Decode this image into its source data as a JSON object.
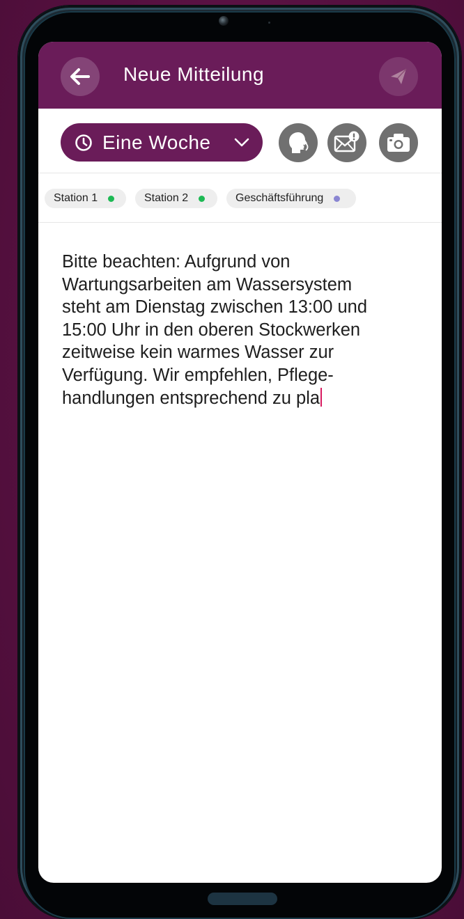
{
  "app_bar": {
    "title": "Neue Mitteilung",
    "back_icon": "arrow-left-icon",
    "send_icon": "paper-plane-icon"
  },
  "toolbar": {
    "duration_label": "Eine Woche",
    "duration_icon": "clock-icon",
    "dropdown_icon": "chevron-down-icon",
    "actions": [
      {
        "icon": "speaking-head-icon"
      },
      {
        "icon": "mail-alert-icon"
      },
      {
        "icon": "camera-icon"
      }
    ]
  },
  "recipients": [
    {
      "label": "Station 1",
      "dot_color": "#1db954"
    },
    {
      "label": "Station 2",
      "dot_color": "#1db954"
    },
    {
      "label": "Geschäftsführung",
      "dot_color": "#8a86d2"
    }
  ],
  "message": {
    "lines": [
      "Bitte beachten: Aufgrund von",
      "Wartungsarbeiten am Wassersystem",
      "steht am Dienstag zwischen 13:00 und",
      "15:00 Uhr in den oberen Stockwerken",
      "zeitweise kein warmes Wasser zur",
      "Verfügung. Wir empfehlen, Pflege-",
      "handlungen entsprechend zu pla"
    ]
  },
  "colors": {
    "primary": "#6a1c59",
    "background": "#5a1245",
    "action_button": "#707070",
    "caret": "#d81b60"
  }
}
